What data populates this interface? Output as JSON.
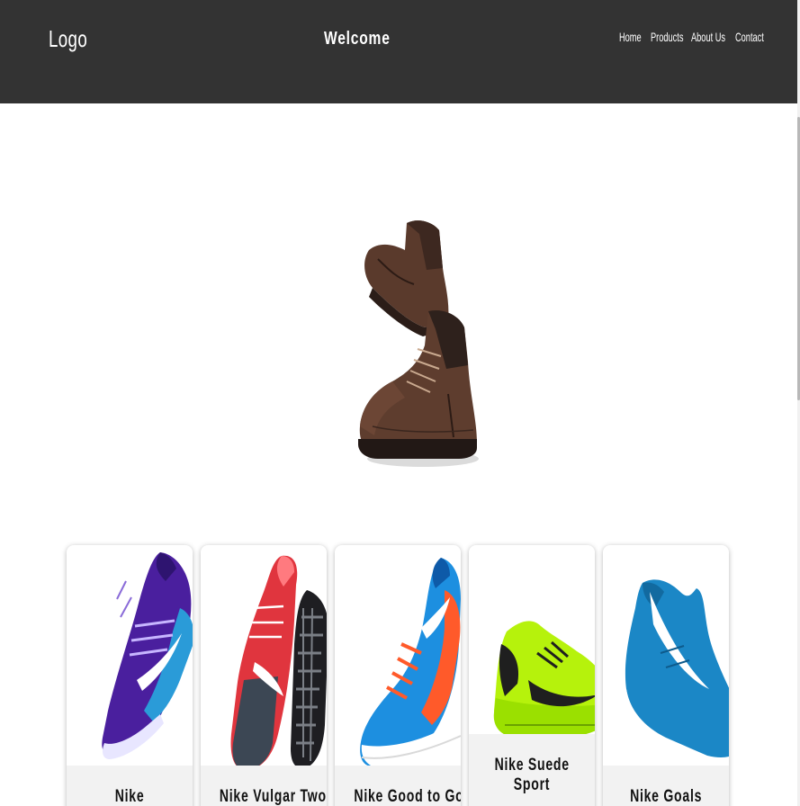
{
  "header": {
    "logo": "Logo",
    "title": "Welcome",
    "nav": [
      "Home",
      "Products",
      "About Us",
      "Contact"
    ]
  },
  "hero": {
    "icon": "brown-leather-boots"
  },
  "products": [
    {
      "name": "Nike",
      "name_line2": "",
      "icon": "purple-running-shoe"
    },
    {
      "name": "Nike Vulgar Two",
      "name_line2": "",
      "icon": "red-grey-running-shoes"
    },
    {
      "name": "Nike Good to Go",
      "name_line2": "",
      "icon": "blue-orange-running-shoe"
    },
    {
      "name": "Nike Suede",
      "name_line2": "Sport",
      "icon": "neon-green-running-shoe"
    },
    {
      "name": "Nike Goals",
      "name_line2": "",
      "icon": "blue-sneaker"
    }
  ],
  "colors": {
    "header_bg": "#333333",
    "header_text": "#ffffff",
    "caption_bg": "#f2f2f2"
  }
}
